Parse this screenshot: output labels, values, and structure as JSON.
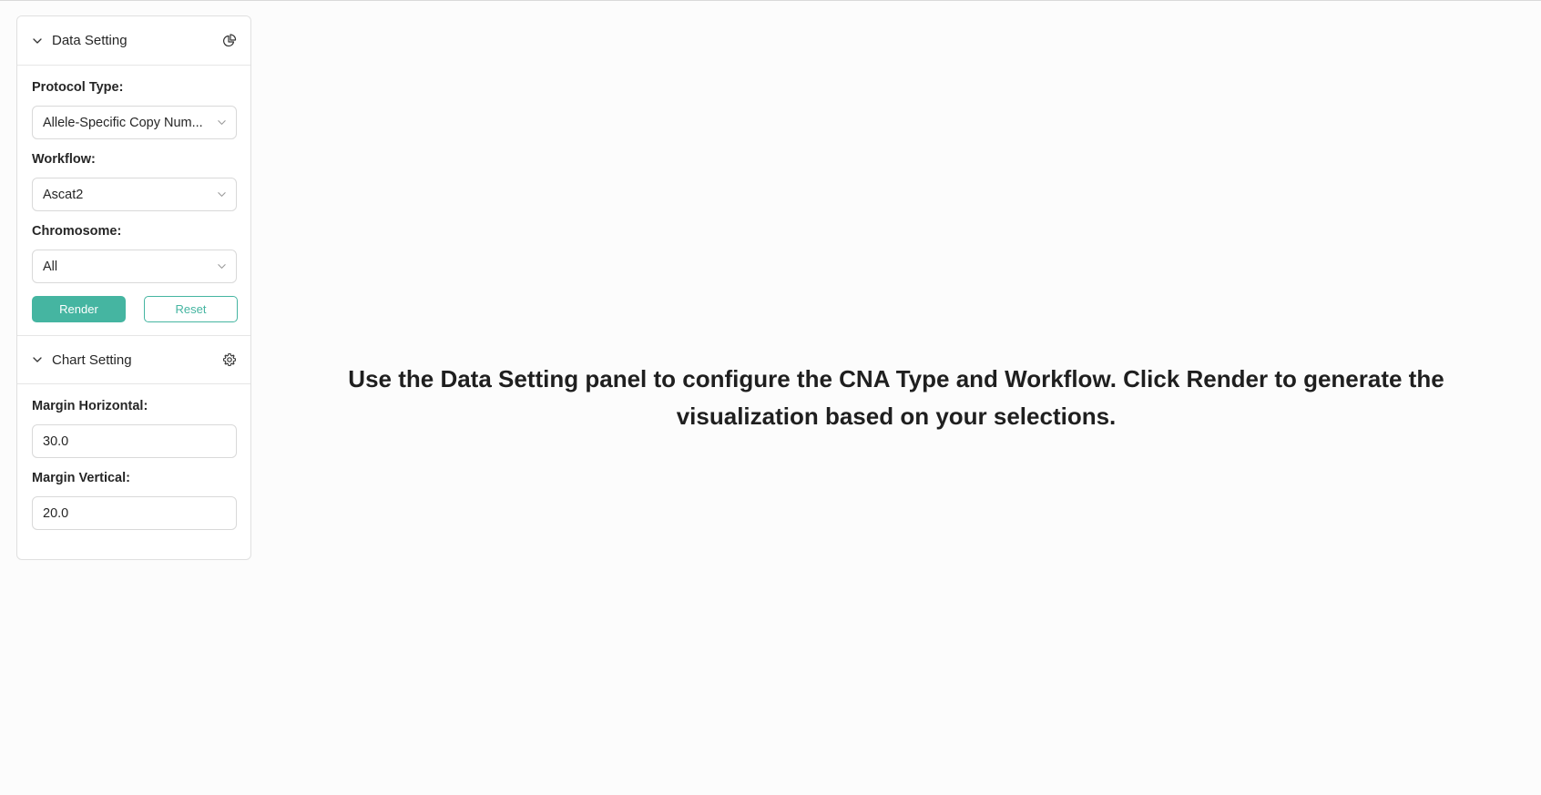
{
  "data_setting": {
    "title": "Data Setting",
    "icon": "pie-chart-icon",
    "collapse_icon": "chevron-down-icon",
    "protocol_type": {
      "label": "Protocol Type:",
      "value": "Allele-Specific Copy Num..."
    },
    "workflow": {
      "label": "Workflow:",
      "value": "Ascat2"
    },
    "chromosome": {
      "label": "Chromosome:",
      "value": "All"
    },
    "render_label": "Render",
    "reset_label": "Reset"
  },
  "chart_setting": {
    "title": "Chart Setting",
    "icon": "gear-icon",
    "collapse_icon": "chevron-down-icon",
    "margin_horizontal": {
      "label": "Margin Horizontal:",
      "value": "30.0"
    },
    "margin_vertical": {
      "label": "Margin Vertical:",
      "value": "20.0"
    }
  },
  "main": {
    "message": "Use the Data Setting panel to configure the CNA Type and Workflow. Click Render to generate the visualization based on your selections."
  },
  "colors": {
    "accent": "#45b5a1",
    "border": "#d9d9d9",
    "text": "#262626"
  }
}
